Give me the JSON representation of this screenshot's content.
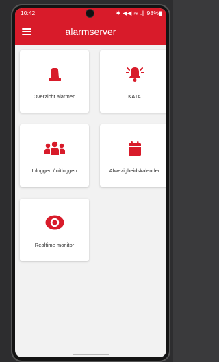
{
  "status_bar": {
    "time": "10:42",
    "icons": "✱ ◀◀ ≋ .∥ 98%▮"
  },
  "app_bar": {
    "title": "alarmserver",
    "menu_icon": "hamburger-menu-icon"
  },
  "tiles": [
    {
      "label": "Overzicht alarmen",
      "icon": "siren-light-icon"
    },
    {
      "label": "KATA",
      "icon": "ringing-bell-icon"
    },
    {
      "label": "Inloggen / uitloggen",
      "icon": "group-users-icon"
    },
    {
      "label": "Afwezigheidskalender",
      "icon": "calendar-icon"
    },
    {
      "label": "Realtime monitor",
      "icon": "eye-icon"
    }
  ],
  "colors": {
    "accent": "#d81b2a",
    "background": "#f2f2f2",
    "tile": "#ffffff"
  }
}
